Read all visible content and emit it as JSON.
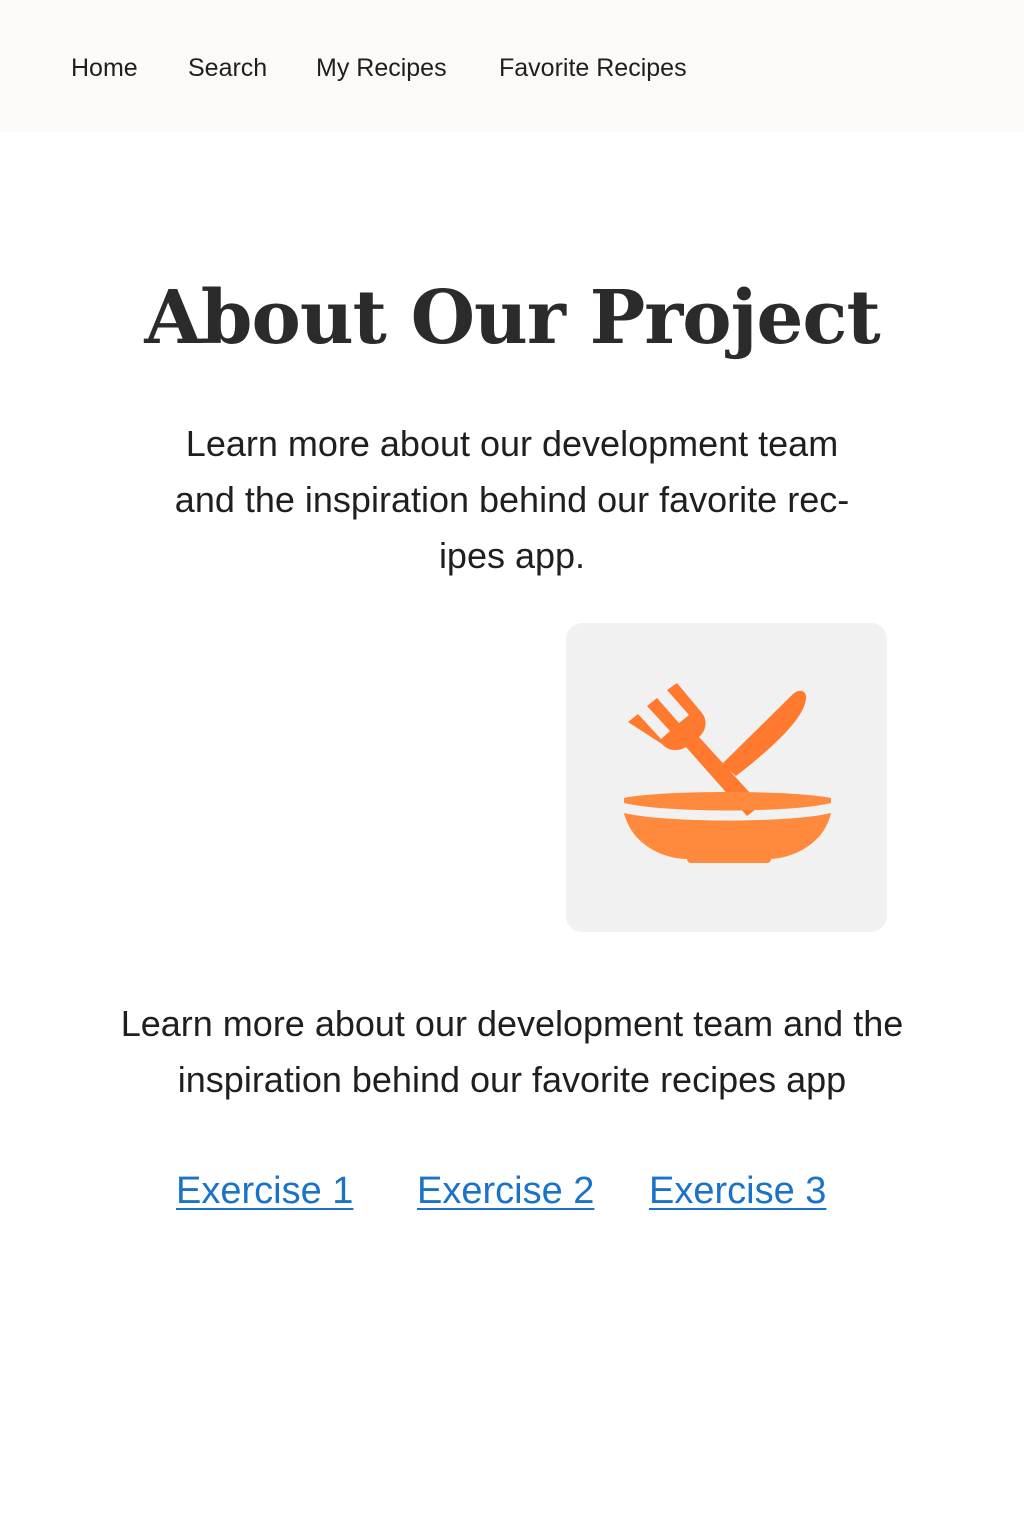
{
  "nav": {
    "items": [
      {
        "label": "Home"
      },
      {
        "label": "Search"
      },
      {
        "label": "My Recipes"
      },
      {
        "label": "Favorite Recipes"
      }
    ]
  },
  "main": {
    "title": "About Our Project",
    "intro": "Learn more about our development team and the inspiration behind our favorite rec-ipes app.",
    "logo_icon": "fork-knife-bowl-icon",
    "summary": "Learn more about our development team and the inspiration behind our favorite recipes app",
    "links": [
      {
        "label": "Exercise 1"
      },
      {
        "label": "Exercise 2"
      },
      {
        "label": "Exercise 3"
      }
    ]
  },
  "colors": {
    "nav_background": "#fbfaf7",
    "logo_orange": "#ff8a3d",
    "logo_card_background": "#f1f1f1",
    "link_blue": "#1a73c9"
  }
}
